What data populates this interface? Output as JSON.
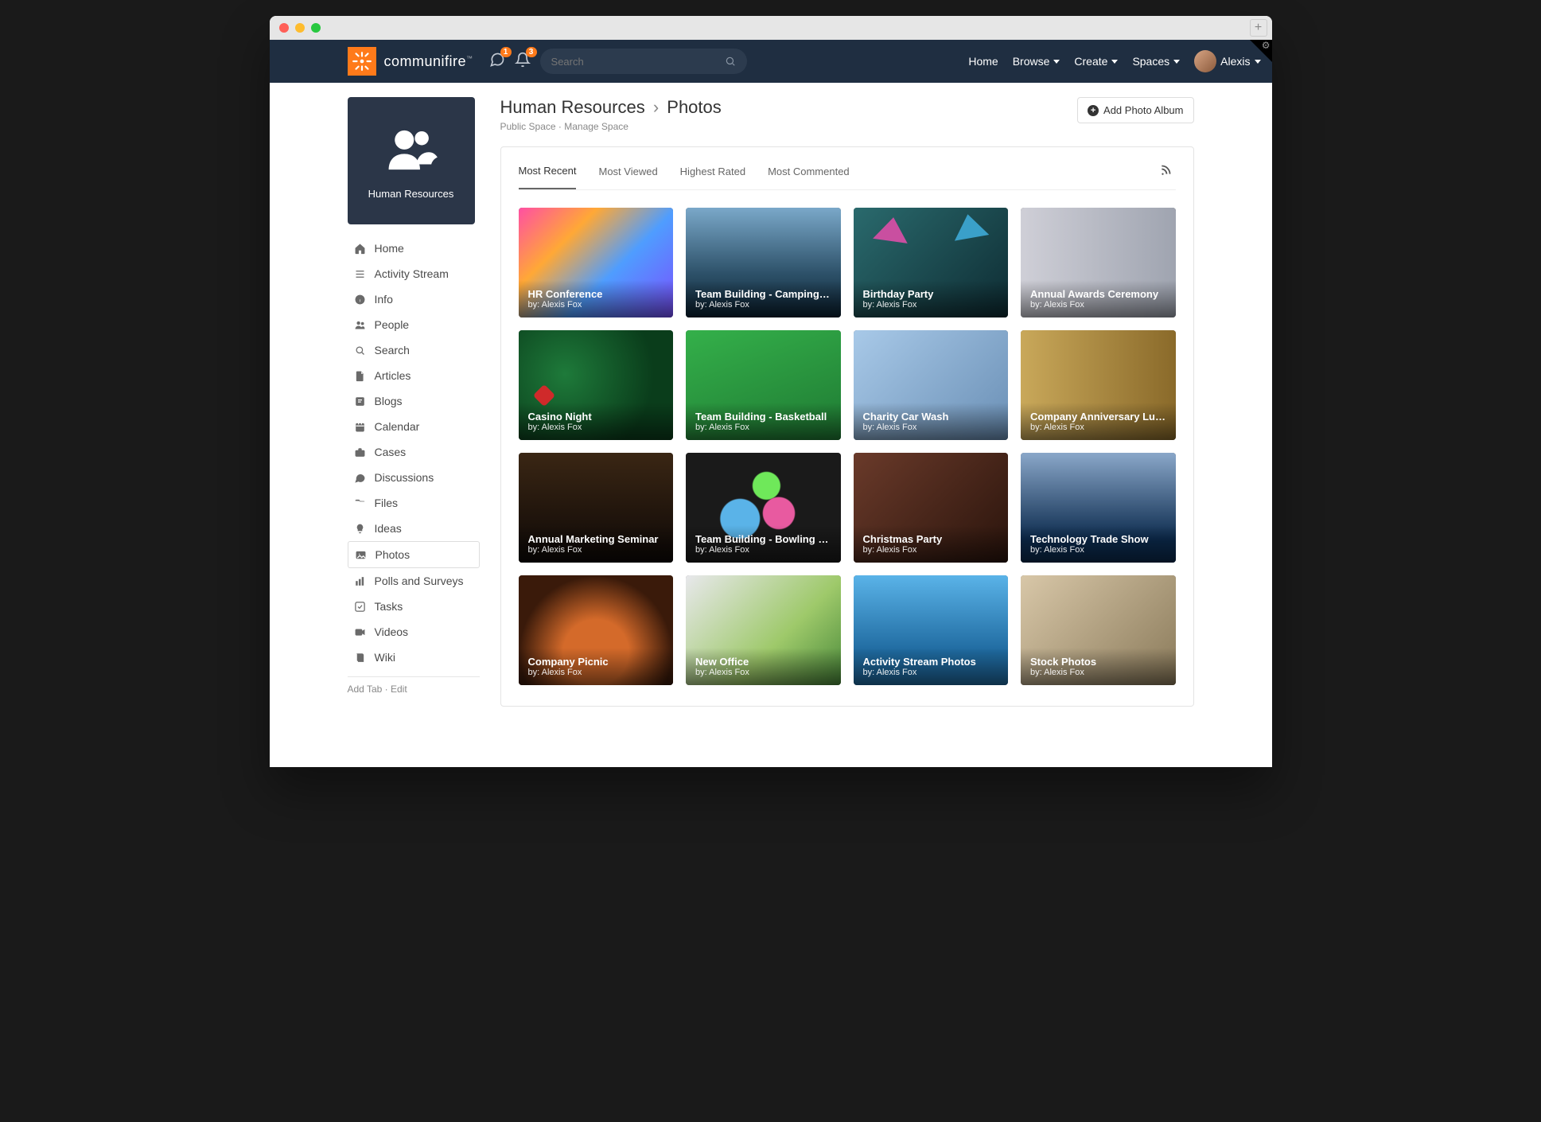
{
  "brand": {
    "name": "communifire",
    "tm": "™"
  },
  "notifications": {
    "chat_count": "1",
    "bell_count": "3"
  },
  "search": {
    "placeholder": "Search"
  },
  "topnav": {
    "home": "Home",
    "browse": "Browse",
    "create": "Create",
    "spaces": "Spaces",
    "user": "Alexis"
  },
  "space": {
    "name": "Human Resources"
  },
  "sidebar": {
    "items": [
      {
        "label": "Home",
        "icon": "home"
      },
      {
        "label": "Activity Stream",
        "icon": "list"
      },
      {
        "label": "Info",
        "icon": "info"
      },
      {
        "label": "People",
        "icon": "people"
      },
      {
        "label": "Search",
        "icon": "search"
      },
      {
        "label": "Articles",
        "icon": "file"
      },
      {
        "label": "Blogs",
        "icon": "blog"
      },
      {
        "label": "Calendar",
        "icon": "calendar"
      },
      {
        "label": "Cases",
        "icon": "briefcase"
      },
      {
        "label": "Discussions",
        "icon": "chat"
      },
      {
        "label": "Files",
        "icon": "folder"
      },
      {
        "label": "Ideas",
        "icon": "bulb"
      },
      {
        "label": "Photos",
        "icon": "image",
        "active": true
      },
      {
        "label": "Polls and Surveys",
        "icon": "chart"
      },
      {
        "label": "Tasks",
        "icon": "check"
      },
      {
        "label": "Videos",
        "icon": "video"
      },
      {
        "label": "Wiki",
        "icon": "book"
      }
    ],
    "footer": {
      "add_tab": "Add Tab",
      "edit": "Edit",
      "sep": " · "
    }
  },
  "page_header": {
    "crumb1": "Human Resources",
    "sep": "›",
    "crumb2": "Photos",
    "sub1": "Public Space",
    "sub_sep": " · ",
    "sub2": "Manage Space",
    "button": "Add Photo Album"
  },
  "tabs": {
    "most_recent": "Most Recent",
    "most_viewed": "Most Viewed",
    "highest_rated": "Highest Rated",
    "most_commented": "Most Commented"
  },
  "by_prefix": "by: ",
  "photos": [
    {
      "title": "HR Conference",
      "author": "Alexis Fox",
      "g": "g1"
    },
    {
      "title": "Team Building - Camping T…",
      "author": "Alexis Fox",
      "g": "g2"
    },
    {
      "title": "Birthday Party",
      "author": "Alexis Fox",
      "g": "g3"
    },
    {
      "title": "Annual Awards Ceremony",
      "author": "Alexis Fox",
      "g": "g4"
    },
    {
      "title": "Casino Night",
      "author": "Alexis Fox",
      "g": "g5"
    },
    {
      "title": "Team Building - Basketball",
      "author": "Alexis Fox",
      "g": "g6"
    },
    {
      "title": "Charity Car Wash",
      "author": "Alexis Fox",
      "g": "g7"
    },
    {
      "title": "Company Anniversary Lun…",
      "author": "Alexis Fox",
      "g": "g8"
    },
    {
      "title": "Annual Marketing Seminar",
      "author": "Alexis Fox",
      "g": "g9"
    },
    {
      "title": "Team Building - Bowling Ni…",
      "author": "Alexis Fox",
      "g": "g10"
    },
    {
      "title": "Christmas Party",
      "author": "Alexis Fox",
      "g": "g11"
    },
    {
      "title": "Technology Trade Show",
      "author": "Alexis Fox",
      "g": "g12"
    },
    {
      "title": "Company Picnic",
      "author": "Alexis Fox",
      "g": "g13"
    },
    {
      "title": "New Office",
      "author": "Alexis Fox",
      "g": "g14"
    },
    {
      "title": "Activity Stream Photos",
      "author": "Alexis Fox",
      "g": "g15"
    },
    {
      "title": "Stock Photos",
      "author": "Alexis Fox",
      "g": "g16"
    }
  ]
}
